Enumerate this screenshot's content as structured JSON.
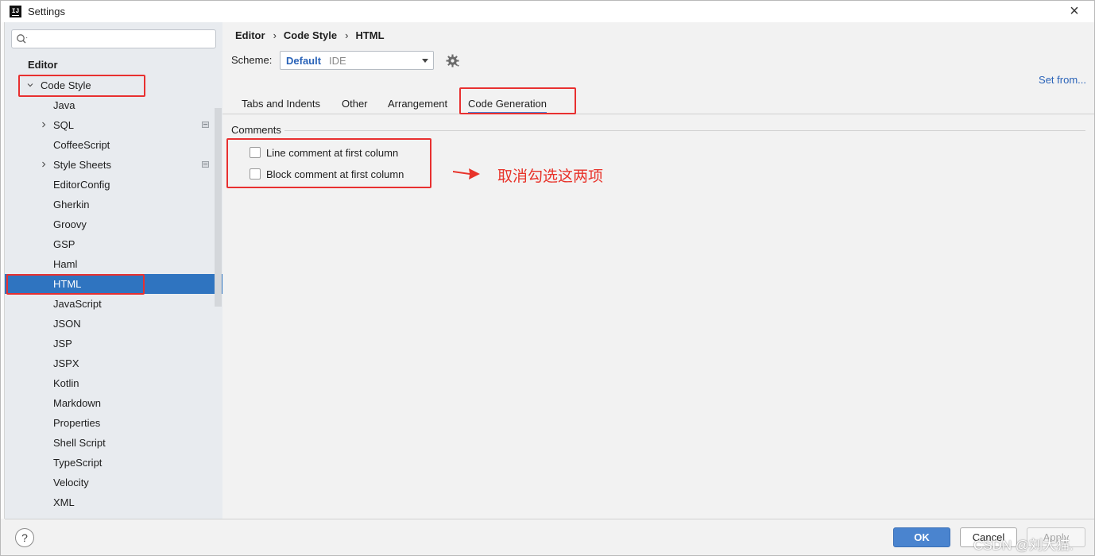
{
  "window": {
    "title": "Settings",
    "app_icon_text": "IJ"
  },
  "search": {
    "placeholder": "",
    "value": ""
  },
  "sidebar": {
    "section": "Editor",
    "code_style_label": "Code Style",
    "items": [
      {
        "label": "Java",
        "expandable": false
      },
      {
        "label": "SQL",
        "expandable": true
      },
      {
        "label": "CoffeeScript",
        "expandable": false
      },
      {
        "label": "Style Sheets",
        "expandable": true
      },
      {
        "label": "EditorConfig",
        "expandable": false
      },
      {
        "label": "Gherkin",
        "expandable": false
      },
      {
        "label": "Groovy",
        "expandable": false
      },
      {
        "label": "GSP",
        "expandable": false
      },
      {
        "label": "Haml",
        "expandable": false
      },
      {
        "label": "HTML",
        "expandable": false,
        "selected": true
      },
      {
        "label": "JavaScript",
        "expandable": false
      },
      {
        "label": "JSON",
        "expandable": false
      },
      {
        "label": "JSP",
        "expandable": false
      },
      {
        "label": "JSPX",
        "expandable": false
      },
      {
        "label": "Kotlin",
        "expandable": false
      },
      {
        "label": "Markdown",
        "expandable": false
      },
      {
        "label": "Properties",
        "expandable": false
      },
      {
        "label": "Shell Script",
        "expandable": false
      },
      {
        "label": "TypeScript",
        "expandable": false
      },
      {
        "label": "Velocity",
        "expandable": false
      },
      {
        "label": "XML",
        "expandable": false
      }
    ]
  },
  "breadcrumb": [
    "Editor",
    "Code Style",
    "HTML"
  ],
  "scheme": {
    "label": "Scheme:",
    "name": "Default",
    "scope": "IDE"
  },
  "set_from": "Set from...",
  "tabs": [
    {
      "label": "Tabs and Indents",
      "active": false
    },
    {
      "label": "Other",
      "active": false
    },
    {
      "label": "Arrangement",
      "active": false
    },
    {
      "label": "Code Generation",
      "active": true
    }
  ],
  "comments": {
    "title": "Comments",
    "options": [
      {
        "label": "Line comment at first column",
        "checked": false
      },
      {
        "label": "Block comment at first column",
        "checked": false
      }
    ]
  },
  "annotation": {
    "text": "取消勾选这两项",
    "color": "#e8332a"
  },
  "footer": {
    "help": "?",
    "ok": "OK",
    "cancel": "Cancel",
    "apply": "Apply"
  },
  "watermark": "CSDN @刘大猫.",
  "colors": {
    "accent": "#2f74c0",
    "link": "#2a63b8",
    "annotation_red": "#e83030"
  }
}
